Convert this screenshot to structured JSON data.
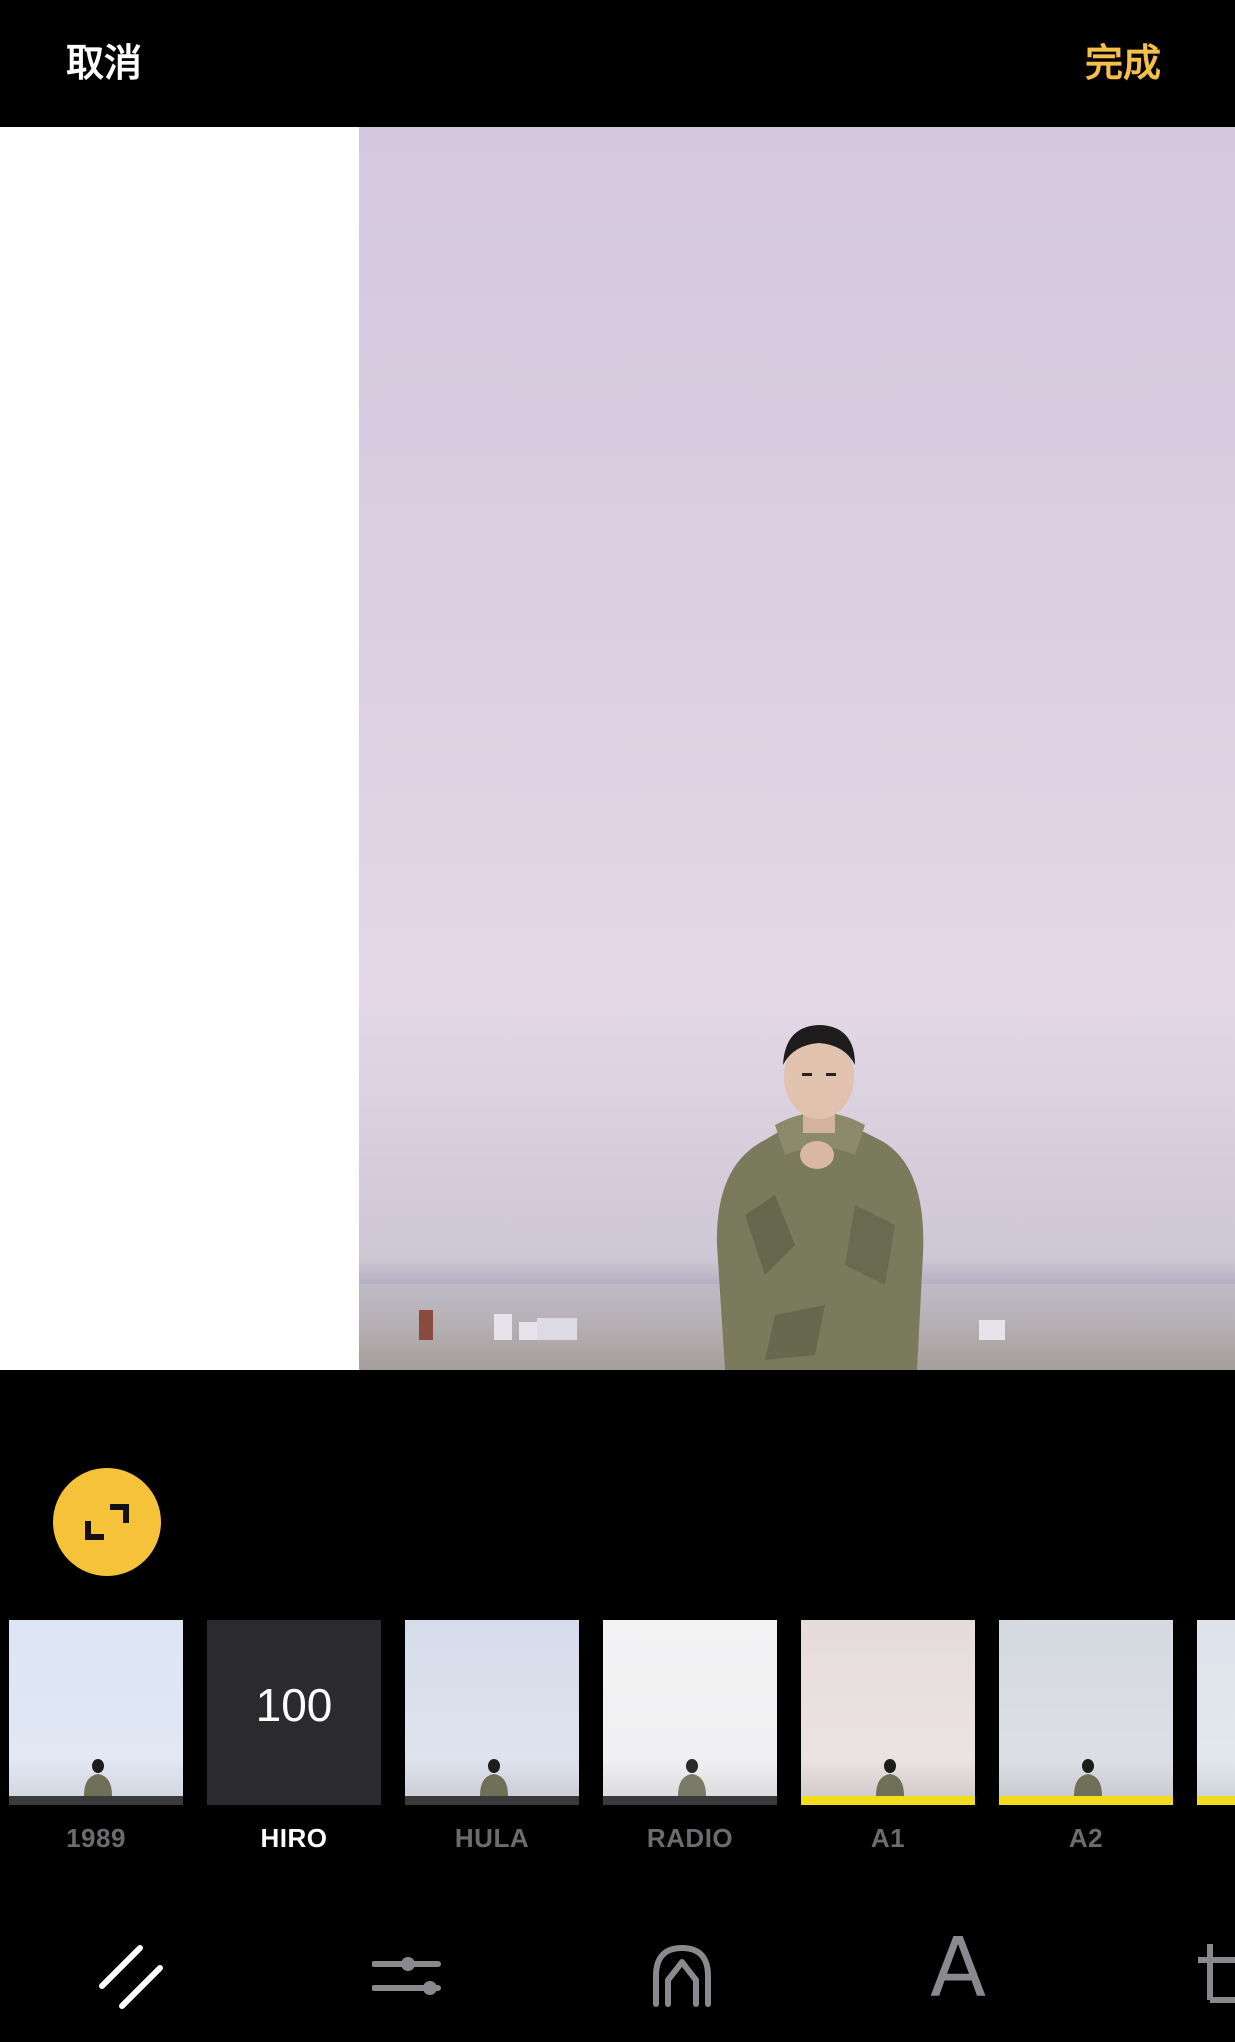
{
  "header": {
    "cancel_label": "取消",
    "done_label": "完成"
  },
  "filters": [
    {
      "label": "1989",
      "active": false
    },
    {
      "label": "HIRO",
      "active": true,
      "intensity": "100"
    },
    {
      "label": "HULA",
      "active": false
    },
    {
      "label": "RADIO",
      "active": false
    },
    {
      "label": "A1",
      "active": false
    },
    {
      "label": "A2",
      "active": false
    }
  ],
  "toolbar": {
    "icons": [
      "filter-slash-icon",
      "adjust-sliders-icon",
      "face-retouch-icon",
      "text-A-icon",
      "crop-partial-icon"
    ],
    "text_tool_glyph": "A"
  },
  "colors": {
    "accent": "#f5c23a",
    "done": "#f5c04a",
    "filter_marker": "#f3dc1c"
  }
}
